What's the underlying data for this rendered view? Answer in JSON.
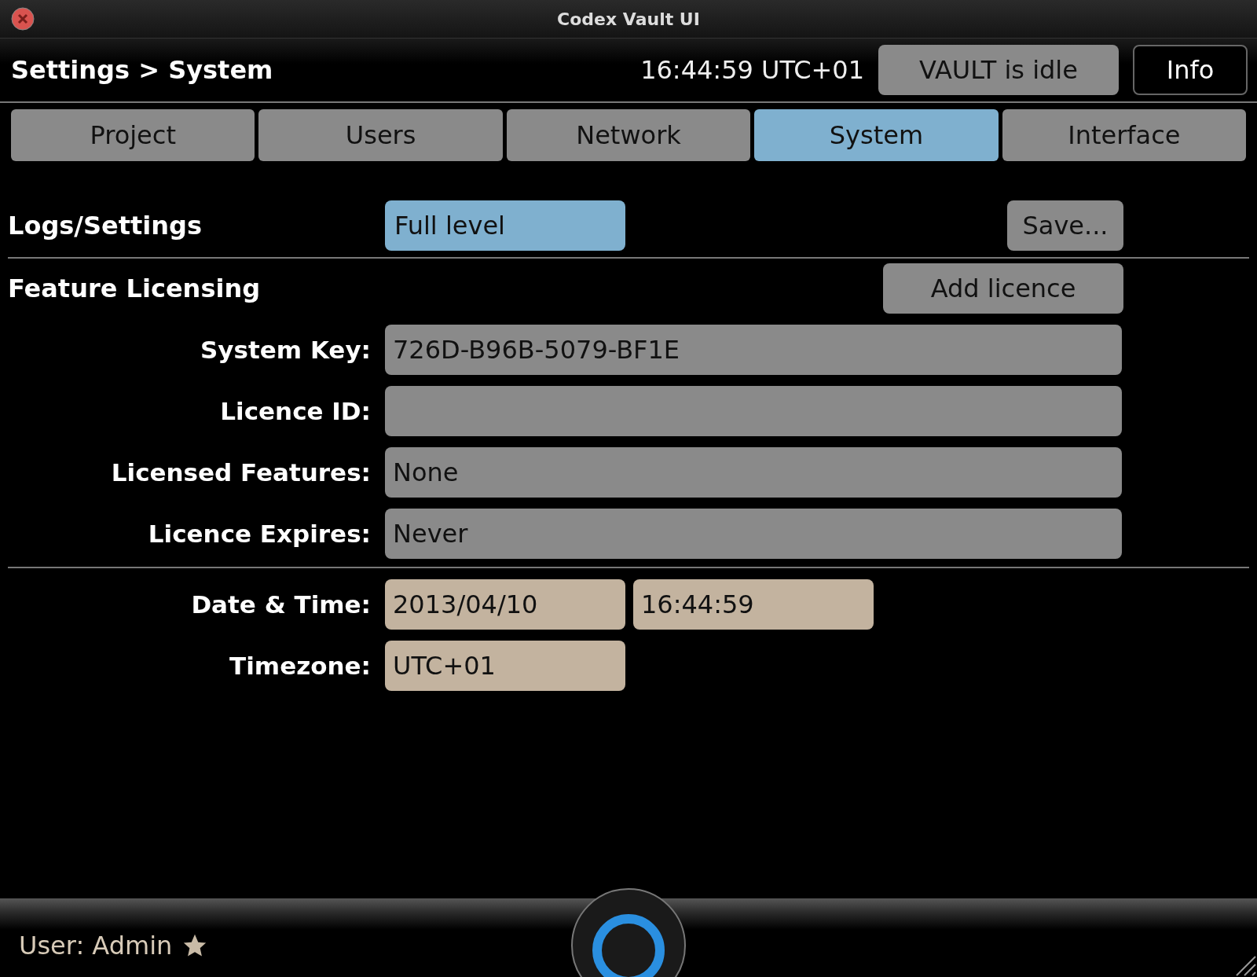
{
  "window": {
    "title": "Codex Vault UI"
  },
  "header": {
    "breadcrumb": "Settings > System",
    "clock": "16:44:59 UTC+01",
    "status": "VAULT is idle",
    "info_button": "Info"
  },
  "tabs": [
    {
      "label": "Project",
      "selected": false
    },
    {
      "label": "Users",
      "selected": false
    },
    {
      "label": "Network",
      "selected": false
    },
    {
      "label": "System",
      "selected": true
    },
    {
      "label": "Interface",
      "selected": false
    }
  ],
  "logs": {
    "label": "Logs/Settings",
    "level_button": "Full level",
    "save_button": "Save..."
  },
  "licensing": {
    "title": "Feature Licensing",
    "add_button": "Add licence",
    "fields": [
      {
        "label": "System Key:",
        "value": "726D-B96B-5079-BF1E"
      },
      {
        "label": "Licence ID:"
      },
      {
        "label": "Licensed Features:",
        "value": "None"
      },
      {
        "label": "Licence Expires:",
        "value": "Never"
      }
    ]
  },
  "datetime": [
    {
      "label": "Date & Time:",
      "values": [
        "2013/04/10",
        "16:44:59"
      ]
    },
    {
      "label": "Timezone:",
      "values": [
        "UTC+01"
      ]
    }
  ],
  "status_bar": {
    "user": "User: Admin"
  }
}
